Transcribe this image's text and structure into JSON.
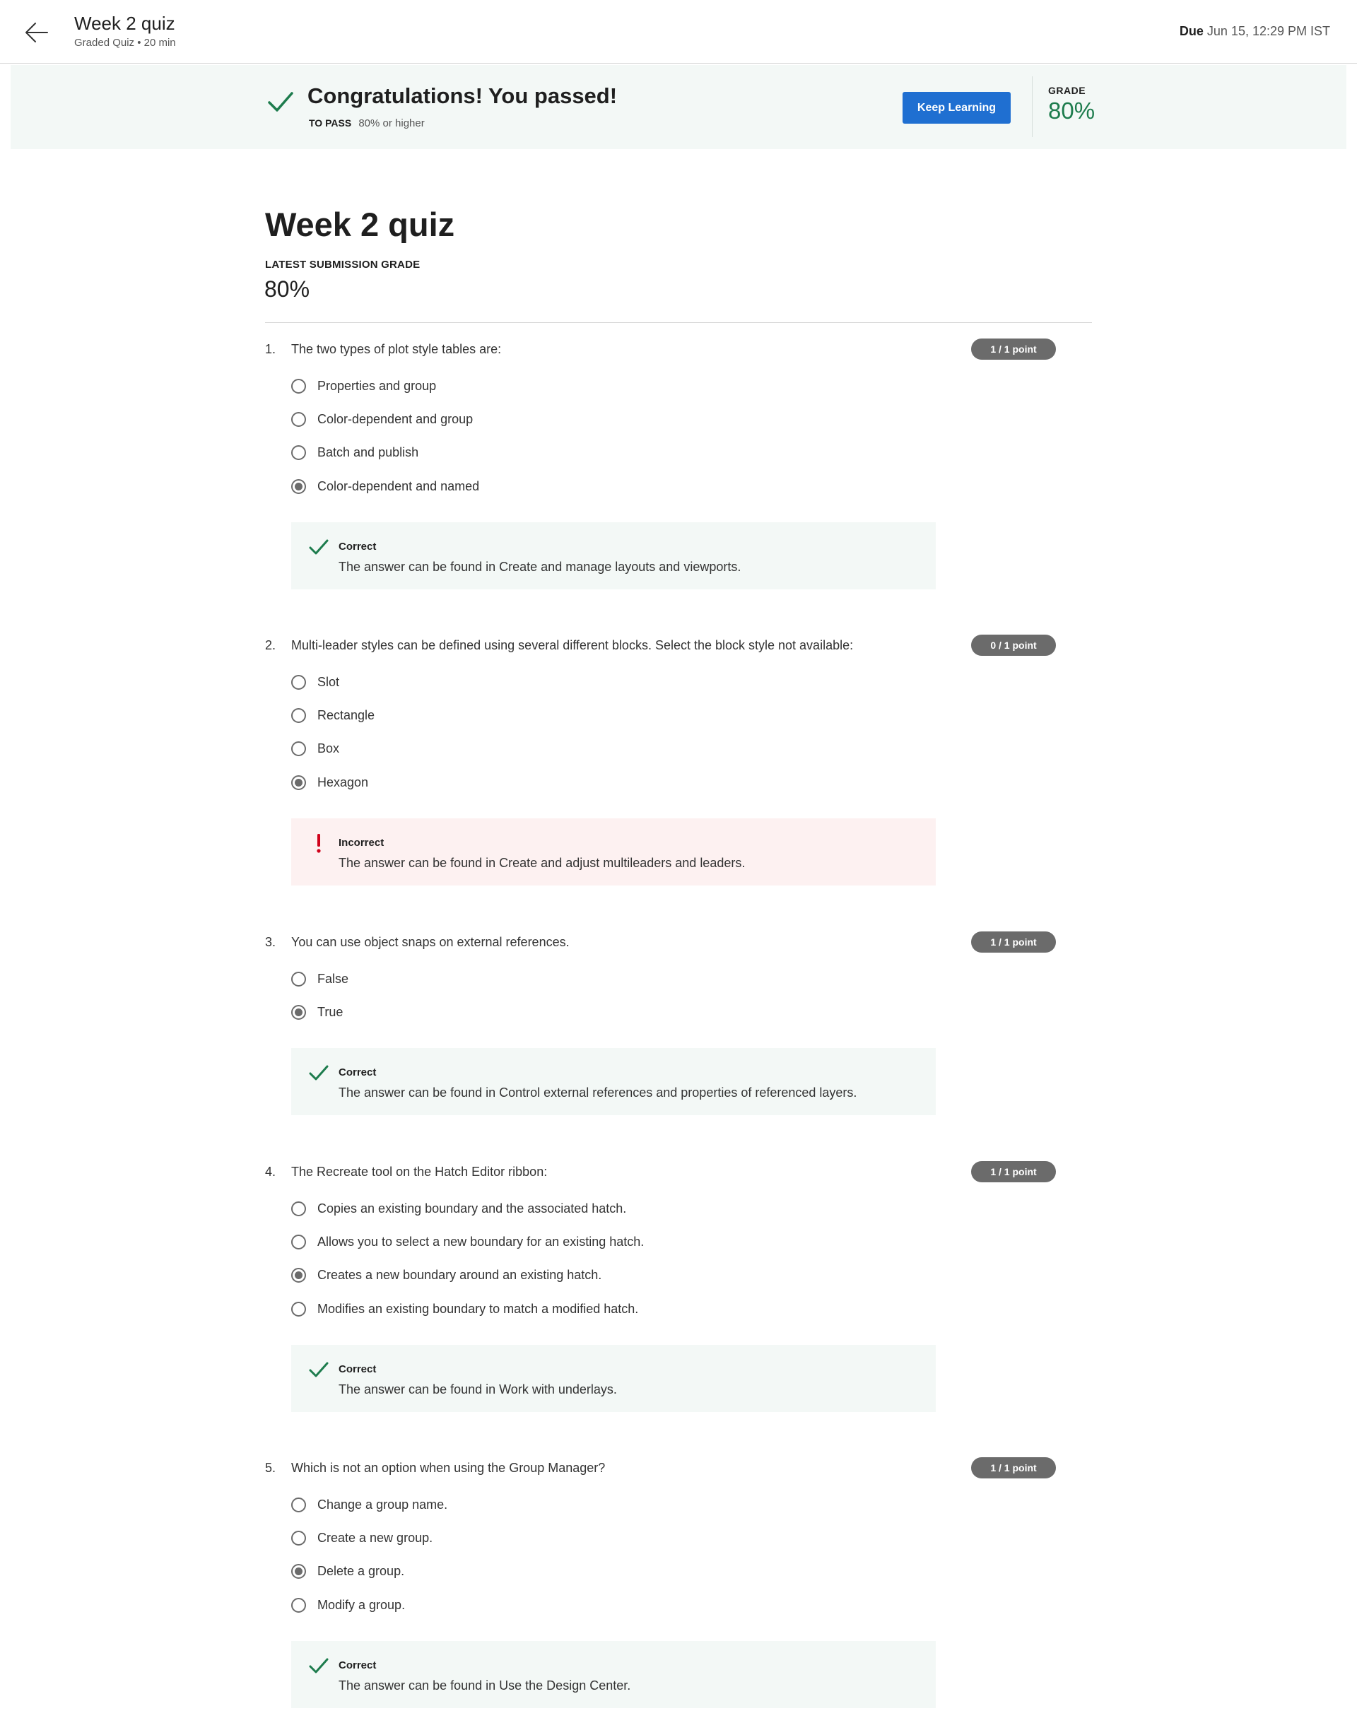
{
  "header": {
    "title": "Week 2 quiz",
    "subtitle": "Graded Quiz • 20 min",
    "due_label": "Due",
    "due_value": "Jun 15, 12:29 PM IST"
  },
  "banner": {
    "title": "Congratulations! You passed!",
    "to_pass_label": "TO PASS",
    "to_pass_value": "80% or higher",
    "button_label": "Keep Learning",
    "grade_label": "GRADE",
    "grade_value": "80%"
  },
  "main": {
    "title": "Week 2 quiz",
    "latest_label": "LATEST SUBMISSION GRADE",
    "latest_value": "80%"
  },
  "colors": {
    "accent_blue": "#1f6fd1",
    "success_green": "#1d7c4d",
    "error_red": "#d0021b",
    "badge_gray": "#6b6b6b"
  },
  "questions": [
    {
      "number": "1.",
      "text": "The two types of plot style tables are:",
      "points": "1 / 1 point",
      "options": [
        "Properties and group",
        "Color-dependent and group",
        "Batch and publish",
        "Color-dependent and named"
      ],
      "selected_index": 3,
      "feedback_status": "Correct",
      "feedback_text": "The answer can be found in Create and manage layouts and viewports.",
      "feedback_icon": "check-icon"
    },
    {
      "number": "2.",
      "text": "Multi-leader styles can be defined using several different blocks. Select the block style not available:",
      "points": "0 / 1 point",
      "options": [
        "Slot",
        "Rectangle",
        "Box",
        "Hexagon"
      ],
      "selected_index": 3,
      "feedback_status": "Incorrect",
      "feedback_text": "The answer can be found in Create and adjust multileaders and leaders.",
      "feedback_icon": "exclamation-icon"
    },
    {
      "number": "3.",
      "text": "You can use object snaps on external references.",
      "points": "1 / 1 point",
      "options": [
        "False",
        "True"
      ],
      "selected_index": 1,
      "feedback_status": "Correct",
      "feedback_text": "The answer can be found in Control external references and properties of referenced layers.",
      "feedback_icon": "check-icon"
    },
    {
      "number": "4.",
      "text": "The Recreate tool on the Hatch Editor ribbon:",
      "points": "1 / 1 point",
      "options": [
        "Copies an existing boundary and the associated hatch.",
        "Allows you to select a new boundary for an existing hatch.",
        "Creates a new boundary around an existing hatch.",
        "Modifies an existing boundary to match a modified hatch."
      ],
      "selected_index": 2,
      "feedback_status": "Correct",
      "feedback_text": "The answer can be found in Work with underlays.",
      "feedback_icon": "check-icon"
    },
    {
      "number": "5.",
      "text": "Which is not an option when using the Group Manager?",
      "points": "1 / 1 point",
      "options": [
        "Change a group name.",
        "Create a new group.",
        "Delete a group.",
        "Modify a group."
      ],
      "selected_index": 2,
      "feedback_status": "Correct",
      "feedback_text": "The answer can be found in Use the Design Center.",
      "feedback_icon": "check-icon"
    }
  ]
}
